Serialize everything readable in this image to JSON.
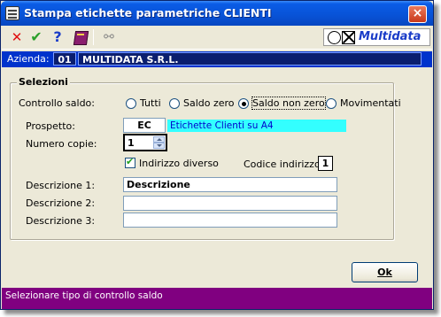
{
  "window": {
    "title": "Stampa etichette parametriche CLIENTI",
    "close_label": "×"
  },
  "toolbar": {
    "icons": [
      "close-icon",
      "confirm-check-icon",
      "help-icon",
      "book-icon",
      "binoculars-icon"
    ],
    "close_glyph": "✕",
    "check_glyph": "✔",
    "help_glyph": "?",
    "bino_glyph": "⚯"
  },
  "logo": {
    "text": "Multidata"
  },
  "company": {
    "label": "Azienda:",
    "code": "01",
    "name": "MULTIDATA S.R.L."
  },
  "selections": {
    "title": "Selezioni",
    "controllo_saldo": {
      "label": "Controllo saldo:",
      "options": [
        "Tutti",
        "Saldo zero",
        "Saldo non zero",
        "Movimentati"
      ],
      "selected": "Saldo non zero"
    },
    "prospetto": {
      "label": "Prospetto:",
      "code": "EC",
      "description": "Etichette Clienti su A4"
    },
    "numero_copie": {
      "label": "Numero copie:",
      "value": "1"
    },
    "indirizzo_diverso": {
      "label": "Indirizzo diverso",
      "checked": true
    },
    "codice_indirizzo": {
      "label": "Codice indirizzo:",
      "value": "1"
    },
    "descrizione1": {
      "label": "Descrizione 1:",
      "value": "Descrizione"
    },
    "descrizione2": {
      "label": "Descrizione 2:",
      "value": ""
    },
    "descrizione3": {
      "label": "Descrizione 3:",
      "value": ""
    }
  },
  "ok_button": {
    "label": "Ok"
  },
  "status": {
    "text": "Selezionare tipo di controllo saldo"
  },
  "colors": {
    "titlebar": "#0852d6",
    "company_bar": "#0033cc",
    "prospetto_desc_bg": "#33ffff",
    "statusbar": "#800080"
  }
}
